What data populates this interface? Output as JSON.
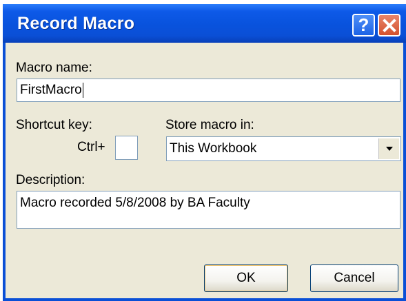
{
  "window": {
    "title": "Record Macro",
    "help_glyph": "?",
    "close_glyph": "✕"
  },
  "macro_name": {
    "label": "Macro name:",
    "value": "FirstMacro"
  },
  "shortcut": {
    "label": "Shortcut key:",
    "prefix": "Ctrl+",
    "value": ""
  },
  "store": {
    "label": "Store macro in:",
    "selected": "This Workbook"
  },
  "description": {
    "label": "Description:",
    "value": "Macro recorded 5/8/2008 by BA Faculty"
  },
  "buttons": {
    "ok": "OK",
    "cancel": "Cancel"
  },
  "icons": {
    "help": "help-icon",
    "close": "close-icon",
    "dropdown": "chevron-down-icon"
  }
}
